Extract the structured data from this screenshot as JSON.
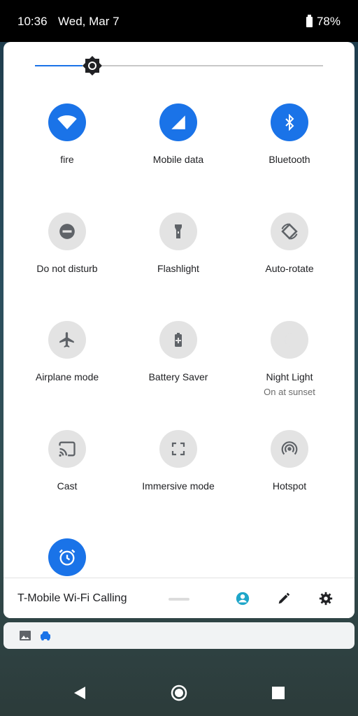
{
  "status_bar": {
    "time": "10:36",
    "date": "Wed, Mar 7",
    "battery": "78%"
  },
  "brightness": {
    "level": 0.2
  },
  "tiles": [
    {
      "label": "fire",
      "active": true,
      "icon": "wifi-icon"
    },
    {
      "label": "Mobile data",
      "active": true,
      "icon": "mobile-data-icon"
    },
    {
      "label": "Bluetooth",
      "active": true,
      "icon": "bluetooth-icon"
    },
    {
      "label": "Do not disturb",
      "active": false,
      "icon": "do-not-disturb-icon"
    },
    {
      "label": "Flashlight",
      "active": false,
      "icon": "flashlight-icon"
    },
    {
      "label": "Auto-rotate",
      "active": false,
      "icon": "auto-rotate-icon"
    },
    {
      "label": "Airplane mode",
      "active": false,
      "icon": "airplane-icon"
    },
    {
      "label": "Battery Saver",
      "active": false,
      "icon": "battery-saver-icon"
    },
    {
      "label": "Night Light",
      "sublabel": "On at sunset",
      "active": false,
      "icon": "moon-icon"
    },
    {
      "label": "Cast",
      "active": false,
      "icon": "cast-icon"
    },
    {
      "label": "Immersive mode",
      "active": false,
      "icon": "immersive-icon"
    },
    {
      "label": "Hotspot",
      "active": false,
      "icon": "hotspot-icon"
    },
    {
      "label": "",
      "active": true,
      "icon": "alarm-icon"
    }
  ],
  "footer": {
    "carrier": "T-Mobile Wi-Fi Calling",
    "icons": [
      "user-icon",
      "edit-icon",
      "settings-icon"
    ]
  },
  "notification": {
    "icons": [
      "image-icon",
      "car-icon"
    ]
  },
  "colors": {
    "accent": "#1a73e8",
    "tile_off": "#e3e3e3"
  }
}
